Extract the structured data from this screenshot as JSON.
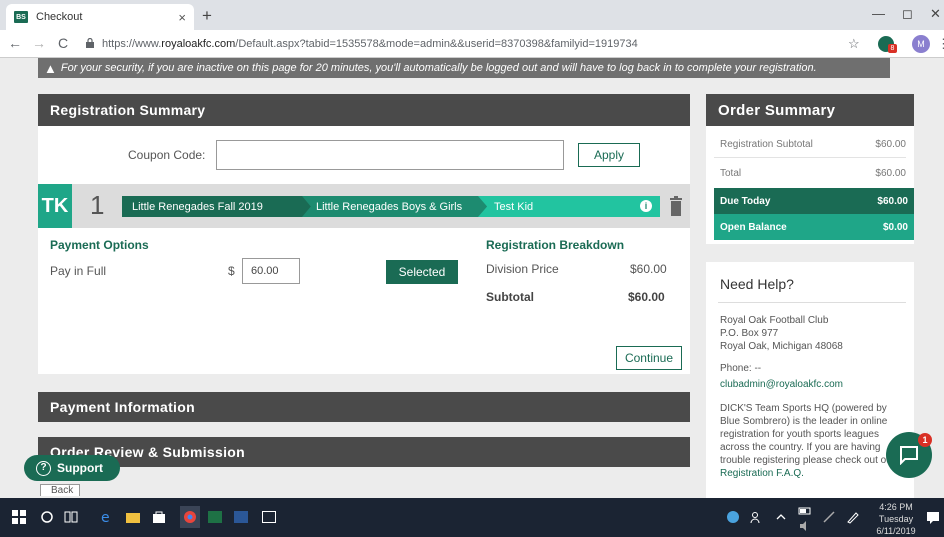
{
  "browser": {
    "tab_title": "Checkout",
    "tab_favicon_text": "BS",
    "tab_close": "×",
    "new_tab": "+",
    "url_prefix": "https://www.",
    "url_host": "royaloakfc.com",
    "url_path": "/Default.aspx?tabid=1535578&mode=admin&&userid=8370398&familyid=1919734",
    "profile_initial": "M",
    "extension_badge": "8",
    "win_minimize": "—",
    "win_restore": "◻",
    "win_close": "✕",
    "star": "☆",
    "menu_dots": "⋮",
    "nav_back": "←",
    "nav_forward": "→",
    "nav_reload": "C"
  },
  "warning": {
    "icon": "▲",
    "text": "For your security, if you are inactive on this page for 20 minutes, you'll automatically be logged out and will have to log back in to complete your registration."
  },
  "registration_summary": {
    "title": "Registration Summary",
    "coupon_label": "Coupon Code:",
    "coupon_value": "",
    "apply_label": "Apply",
    "player_initials": "TK",
    "registration_number": "1",
    "breadcrumbs": [
      "Little Renegades Fall 2019",
      "Little Renegades Boys & Girls",
      "Test Kid"
    ],
    "payment_options_title": "Payment Options",
    "pay_option_label": "Pay in Full",
    "currency_symbol": "$",
    "amount_value": "60.00",
    "selected_label": "Selected",
    "breakdown_title": "Registration Breakdown",
    "division_price_label": "Division Price",
    "division_price_value": "$60.00",
    "subtotal_label": "Subtotal",
    "subtotal_value": "$60.00",
    "continue_label": "Continue"
  },
  "payment_information": {
    "title": "Payment Information"
  },
  "order_review": {
    "title": "Order Review & Submission"
  },
  "order_summary": {
    "title": "Order Summary",
    "rows": [
      {
        "label": "Registration Subtotal",
        "value": "$60.00"
      },
      {
        "label": "Total",
        "value": "$60.00"
      },
      {
        "label": "Due Today",
        "value": "$60.00"
      },
      {
        "label": "Open Balance",
        "value": "$0.00"
      }
    ]
  },
  "help": {
    "title": "Need Help?",
    "org_name": "Royal Oak Football Club",
    "address_1": "P.O. Box 977",
    "address_2": "Royal Oak, Michigan 48068",
    "phone": "Phone: --",
    "email": "clubadmin@royaloakfc.com",
    "blurb": "DICK'S Team Sports HQ (powered by Blue Sombrero) is the leader in online registration for youth sports leagues across the country. If you are having trouble registering please check out our",
    "faq_link": "Registration F.A.Q."
  },
  "support": {
    "label": "Support",
    "icon": "?",
    "back_label": "Back"
  },
  "chat": {
    "badge": "1"
  },
  "taskbar": {
    "time": "4:26 PM",
    "day": "Tuesday",
    "date": "6/11/2019"
  },
  "colors": {
    "brand_green": "#1a6b54",
    "teal": "#1fa688",
    "header_gray": "#4a4a4a",
    "alert_red": "#d93025"
  }
}
